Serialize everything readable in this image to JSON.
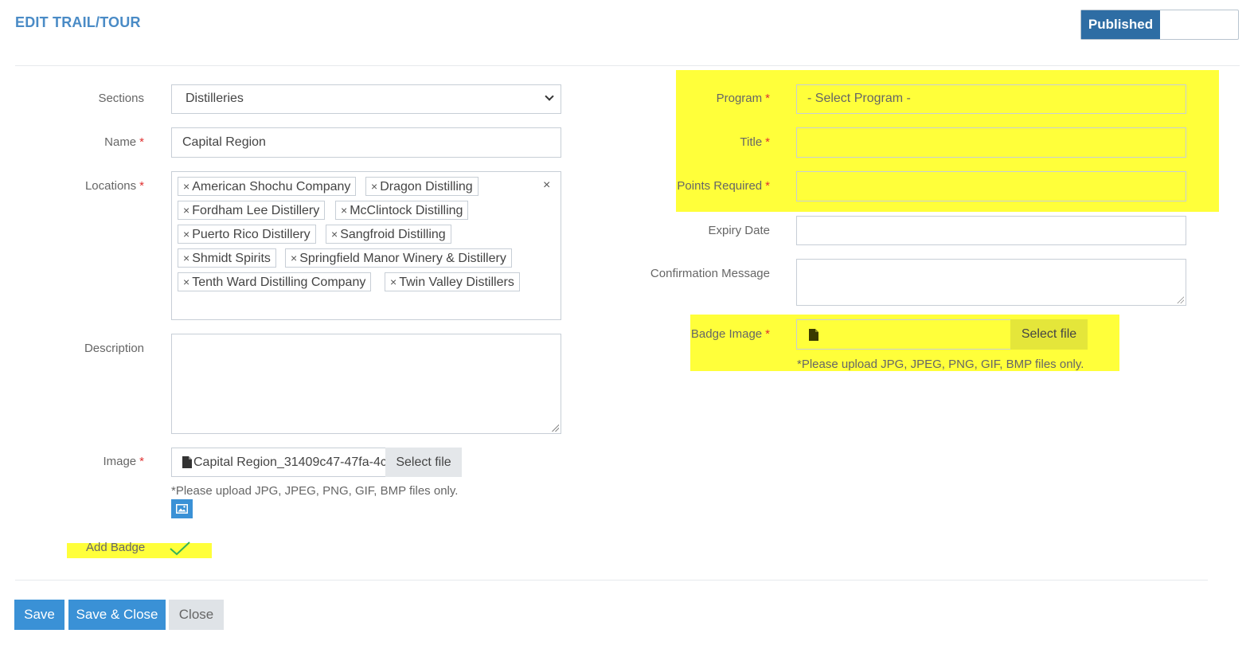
{
  "header": {
    "title": "EDIT TRAIL/TOUR",
    "published_label": "Published"
  },
  "form_left": {
    "sections": {
      "label": "Sections",
      "value": "Distilleries"
    },
    "name": {
      "label": "Name",
      "value": "Capital Region"
    },
    "locations": {
      "label": "Locations",
      "clear_symbol": "×",
      "tags": [
        "American Shochu Company",
        "Dragon Distilling",
        "Fordham Lee Distillery",
        "McClintock Distilling",
        "Puerto Rico Distillery",
        "Sangfroid Distilling",
        "Shmidt Spirits",
        "Springfield Manor Winery & Distillery",
        "Tenth Ward Distilling Company",
        "Twin Valley Distillers"
      ]
    },
    "description": {
      "label": "Description",
      "value": ""
    },
    "image": {
      "label": "Image",
      "filename": "Capital Region_31409c47-47fa-4c",
      "select_label": "Select file",
      "hint": "*Please upload JPG, JPEG, PNG, GIF, BMP files only."
    },
    "add_badge": {
      "label": "Add Badge"
    }
  },
  "form_right": {
    "program": {
      "label": "Program",
      "placeholder": "- Select Program -"
    },
    "title": {
      "label": "Title",
      "value": ""
    },
    "points_required": {
      "label": "Points Required",
      "value": ""
    },
    "expiry_date": {
      "label": "Expiry Date",
      "value": ""
    },
    "confirmation_message": {
      "label": "Confirmation Message",
      "value": ""
    },
    "badge_image": {
      "label": "Badge Image",
      "select_label": "Select file",
      "hint": "*Please upload JPG, JPEG, PNG, GIF, BMP files only."
    }
  },
  "footer": {
    "save_label": "Save",
    "save_close_label": "Save & Close",
    "close_label": "Close"
  },
  "colors": {
    "accent": "#3a91d6",
    "highlight": "#ffff3a",
    "required": "#e03030",
    "title": "#4a8bc6"
  },
  "icons": [
    "chevron-down-icon",
    "remove-tag-icon",
    "clear-all-icon",
    "file-icon",
    "image-preview-icon",
    "checkmark-icon",
    "resize-grip-icon"
  ]
}
